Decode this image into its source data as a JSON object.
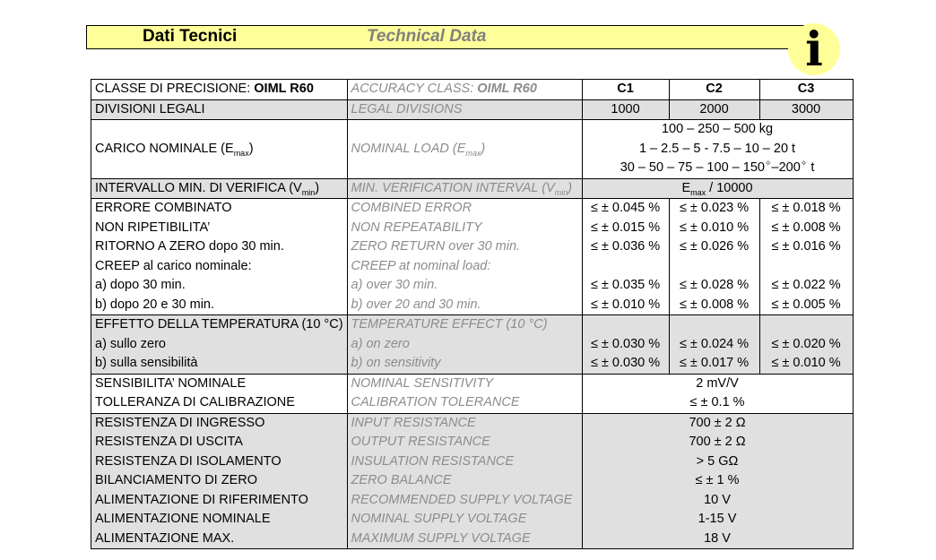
{
  "header": {
    "title_it": "Dati Tecnici",
    "title_en": "Technical Data",
    "info_glyph": "i"
  },
  "accuracy_class": {
    "it_prefix": "CLASSE DI PRECISIONE: ",
    "it_value": "OIML R60",
    "en_prefix": "ACCURACY CLASS: ",
    "en_value": "OIML R60",
    "classes": [
      "C1",
      "C2",
      "C3"
    ]
  },
  "legal_divisions": {
    "it": "DIVISIONI LEGALI",
    "en": "LEGAL DIVISIONS",
    "values": [
      "1000",
      "2000",
      "3000"
    ]
  },
  "nominal_load": {
    "it_prefix": "CARICO NOMINALE (E",
    "it_sub": "max",
    "it_suffix": ")",
    "en_prefix": "NOMINAL LOAD (E",
    "en_sub": "max",
    "en_suffix": ")",
    "line1": "100 – 250 – 500 kg",
    "line2": "1 – 2.5 – 5 - 7.5 – 10 – 20 t",
    "line3_a": "30 – 50 – 75 – 100 – 150",
    "line3_b": "–200",
    "line3_c": " t",
    "mark": "✧"
  },
  "min_verification": {
    "it_prefix": "INTERVALLO MIN. DI VERIFICA (V",
    "it_sub": "min",
    "it_suffix": ")",
    "en_prefix": "MIN. VERIFICATION INTERVAL (V",
    "en_sub": "min",
    "en_suffix": ")",
    "value_prefix": "E",
    "value_sub": "max",
    "value_suffix": " / 10000"
  },
  "errors": {
    "it": [
      "ERRORE COMBINATO",
      "NON RIPETIBILITA’",
      "RITORNO A ZERO dopo 30 min.",
      "CREEP al carico nominale:",
      "a) dopo 30 min.",
      "b) dopo 20 e 30 min."
    ],
    "en": [
      "COMBINED ERROR",
      "NON REPEATABILITY",
      "ZERO RETURN over 30 min.",
      "CREEP at nominal load:",
      "a) over 30 min.",
      "b) over 20 and 30 min."
    ],
    "c1": [
      "≤ ± 0.045 %",
      "≤ ± 0.015 %",
      "≤ ± 0.036 %",
      "",
      "≤ ± 0.035 %",
      "≤ ± 0.010 %"
    ],
    "c2": [
      "≤ ± 0.023 %",
      "≤ ± 0.010 %",
      "≤ ± 0.026 %",
      "",
      "≤ ± 0.028 %",
      "≤ ± 0.008 %"
    ],
    "c3": [
      "≤ ± 0.018 %",
      "≤ ± 0.008 %",
      "≤ ± 0.016 %",
      "",
      "≤ ± 0.022 %",
      "≤ ± 0.005 %"
    ]
  },
  "temperature": {
    "it": [
      "EFFETTO DELLA TEMPERATURA (10 °C)",
      "a) sullo zero",
      "b) sulla sensibilità"
    ],
    "en": [
      "TEMPERATURE EFFECT (10 °C)",
      "a) on zero",
      "b) on sensitivity"
    ],
    "c1": [
      "",
      "≤ ± 0.030 %",
      "≤ ± 0.030 %"
    ],
    "c2": [
      "",
      "≤ ± 0.024 %",
      "≤ ± 0.017 %"
    ],
    "c3": [
      "",
      "≤ ± 0.020 %",
      "≤ ± 0.010 %"
    ]
  },
  "sensitivity": {
    "it": [
      "SENSIBILITA’ NOMINALE",
      "TOLLERANZA DI CALIBRAZIONE"
    ],
    "en": [
      "NOMINAL SENSITIVITY",
      "CALIBRATION TOLERANCE"
    ],
    "values": [
      "2 mV/V",
      "≤ ± 0.1 %"
    ]
  },
  "electrical": {
    "it": [
      "RESISTENZA DI INGRESSO",
      "RESISTENZA DI USCITA",
      "RESISTENZA DI ISOLAMENTO",
      "BILANCIAMENTO DI ZERO",
      "ALIMENTAZIONE DI RIFERIMENTO",
      "ALIMENTAZIONE NOMINALE",
      "ALIMENTAZIONE MAX."
    ],
    "en": [
      "INPUT RESISTANCE",
      "OUTPUT RESISTANCE",
      "INSULATION RESISTANCE",
      "ZERO BALANCE",
      "RECOMMENDED SUPPLY VOLTAGE",
      "NOMINAL SUPPLY VOLTAGE",
      "MAXIMUM SUPPLY VOLTAGE"
    ],
    "values": [
      "700 ± 2 Ω",
      "700 ± 2 Ω",
      "> 5 GΩ",
      "≤ ± 1 %",
      "10 V",
      "1-15 V",
      "18 V"
    ]
  }
}
